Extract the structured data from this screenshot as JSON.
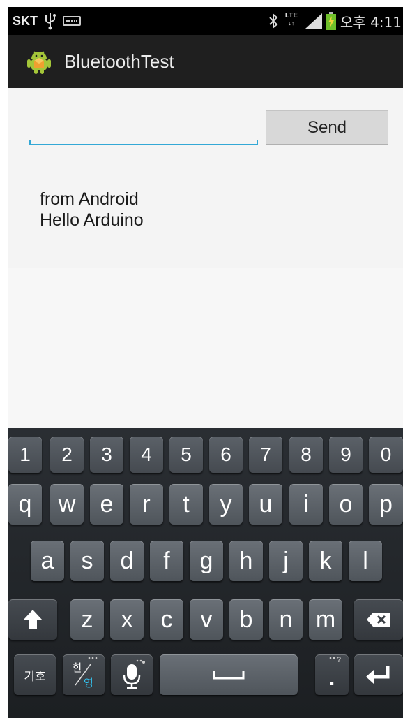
{
  "status_bar": {
    "carrier": "SKT",
    "time": "오후 4:11",
    "network": "LTE",
    "icons": [
      "usb-icon",
      "keyboard-icon",
      "bluetooth-icon",
      "lte-icon",
      "signal-icon",
      "battery-charging-icon"
    ]
  },
  "action_bar": {
    "title": "BluetoothTest",
    "icon": "android-app-icon"
  },
  "form": {
    "input_value": "",
    "send_label": "Send"
  },
  "received_lines": [
    "from Android",
    "Hello Arduino"
  ],
  "keyboard": {
    "number_row": [
      "1",
      "2",
      "3",
      "4",
      "5",
      "6",
      "7",
      "8",
      "9",
      "0"
    ],
    "row1": [
      "q",
      "w",
      "e",
      "r",
      "t",
      "y",
      "u",
      "i",
      "o",
      "p"
    ],
    "row2": [
      "a",
      "s",
      "d",
      "f",
      "g",
      "h",
      "j",
      "k",
      "l"
    ],
    "row3": [
      "z",
      "x",
      "c",
      "v",
      "b",
      "n",
      "m"
    ],
    "symbol_key": "기호",
    "lang_key_top": "한",
    "lang_key_bottom": "영",
    "period_key": "."
  },
  "colors": {
    "accent": "#33a8d6",
    "actionbar": "#1f1f1f",
    "content_bg": "#f4f4f4"
  }
}
